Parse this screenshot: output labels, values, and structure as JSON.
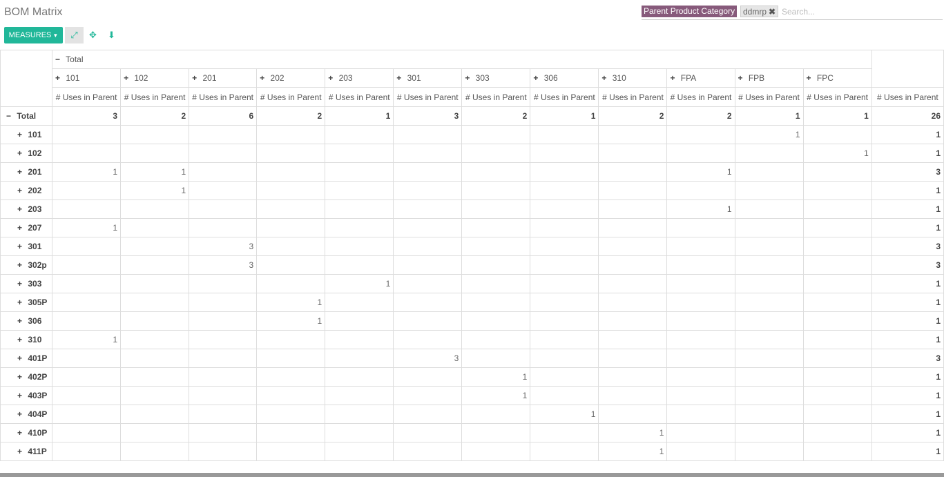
{
  "header": {
    "title": "BOM Matrix",
    "facet_category": "Parent Product Category",
    "facet_value": "ddmrp",
    "search_placeholder": "Search..."
  },
  "toolbar": {
    "measures_label": "MEASURES",
    "expand_icon": "expand-arrows-icon",
    "flip_icon": "flip-axis-icon",
    "download_icon": "download-icon"
  },
  "pivot": {
    "col_total_label": "Total",
    "measure_label": "# Uses in Parent",
    "row_total_label": "Total",
    "columns": [
      "101",
      "102",
      "201",
      "202",
      "203",
      "301",
      "303",
      "306",
      "310",
      "FPA",
      "FPB",
      "FPC"
    ],
    "grand": {
      "values": [
        "3",
        "2",
        "6",
        "2",
        "1",
        "3",
        "2",
        "1",
        "2",
        "2",
        "1",
        "1"
      ],
      "total": "26"
    },
    "rows": [
      {
        "label": "101",
        "cells": [
          "",
          "",
          "",
          "",
          "",
          "",
          "",
          "",
          "",
          "",
          "1",
          ""
        ],
        "total": "1"
      },
      {
        "label": "102",
        "cells": [
          "",
          "",
          "",
          "",
          "",
          "",
          "",
          "",
          "",
          "",
          "",
          "1"
        ],
        "total": "1"
      },
      {
        "label": "201",
        "cells": [
          "1",
          "1",
          "",
          "",
          "",
          "",
          "",
          "",
          "",
          "1",
          "",
          ""
        ],
        "total": "3"
      },
      {
        "label": "202",
        "cells": [
          "",
          "1",
          "",
          "",
          "",
          "",
          "",
          "",
          "",
          "",
          "",
          ""
        ],
        "total": "1"
      },
      {
        "label": "203",
        "cells": [
          "",
          "",
          "",
          "",
          "",
          "",
          "",
          "",
          "",
          "1",
          "",
          ""
        ],
        "total": "1"
      },
      {
        "label": "207",
        "cells": [
          "1",
          "",
          "",
          "",
          "",
          "",
          "",
          "",
          "",
          "",
          "",
          ""
        ],
        "total": "1"
      },
      {
        "label": "301",
        "cells": [
          "",
          "",
          "3",
          "",
          "",
          "",
          "",
          "",
          "",
          "",
          "",
          ""
        ],
        "total": "3"
      },
      {
        "label": "302p",
        "cells": [
          "",
          "",
          "3",
          "",
          "",
          "",
          "",
          "",
          "",
          "",
          "",
          ""
        ],
        "total": "3"
      },
      {
        "label": "303",
        "cells": [
          "",
          "",
          "",
          "",
          "1",
          "",
          "",
          "",
          "",
          "",
          "",
          ""
        ],
        "total": "1"
      },
      {
        "label": "305P",
        "cells": [
          "",
          "",
          "",
          "1",
          "",
          "",
          "",
          "",
          "",
          "",
          "",
          ""
        ],
        "total": "1"
      },
      {
        "label": "306",
        "cells": [
          "",
          "",
          "",
          "1",
          "",
          "",
          "",
          "",
          "",
          "",
          "",
          ""
        ],
        "total": "1"
      },
      {
        "label": "310",
        "cells": [
          "1",
          "",
          "",
          "",
          "",
          "",
          "",
          "",
          "",
          "",
          "",
          ""
        ],
        "total": "1"
      },
      {
        "label": "401P",
        "cells": [
          "",
          "",
          "",
          "",
          "",
          "3",
          "",
          "",
          "",
          "",
          "",
          ""
        ],
        "total": "3"
      },
      {
        "label": "402P",
        "cells": [
          "",
          "",
          "",
          "",
          "",
          "",
          "1",
          "",
          "",
          "",
          "",
          ""
        ],
        "total": "1"
      },
      {
        "label": "403P",
        "cells": [
          "",
          "",
          "",
          "",
          "",
          "",
          "1",
          "",
          "",
          "",
          "",
          ""
        ],
        "total": "1"
      },
      {
        "label": "404P",
        "cells": [
          "",
          "",
          "",
          "",
          "",
          "",
          "",
          "1",
          "",
          "",
          "",
          ""
        ],
        "total": "1"
      },
      {
        "label": "410P",
        "cells": [
          "",
          "",
          "",
          "",
          "",
          "",
          "",
          "",
          "1",
          "",
          "",
          ""
        ],
        "total": "1"
      },
      {
        "label": "411P",
        "cells": [
          "",
          "",
          "",
          "",
          "",
          "",
          "",
          "",
          "1",
          "",
          "",
          ""
        ],
        "total": "1"
      }
    ]
  },
  "colors": {
    "accent": "#21b799",
    "facet": "#875a7b"
  }
}
